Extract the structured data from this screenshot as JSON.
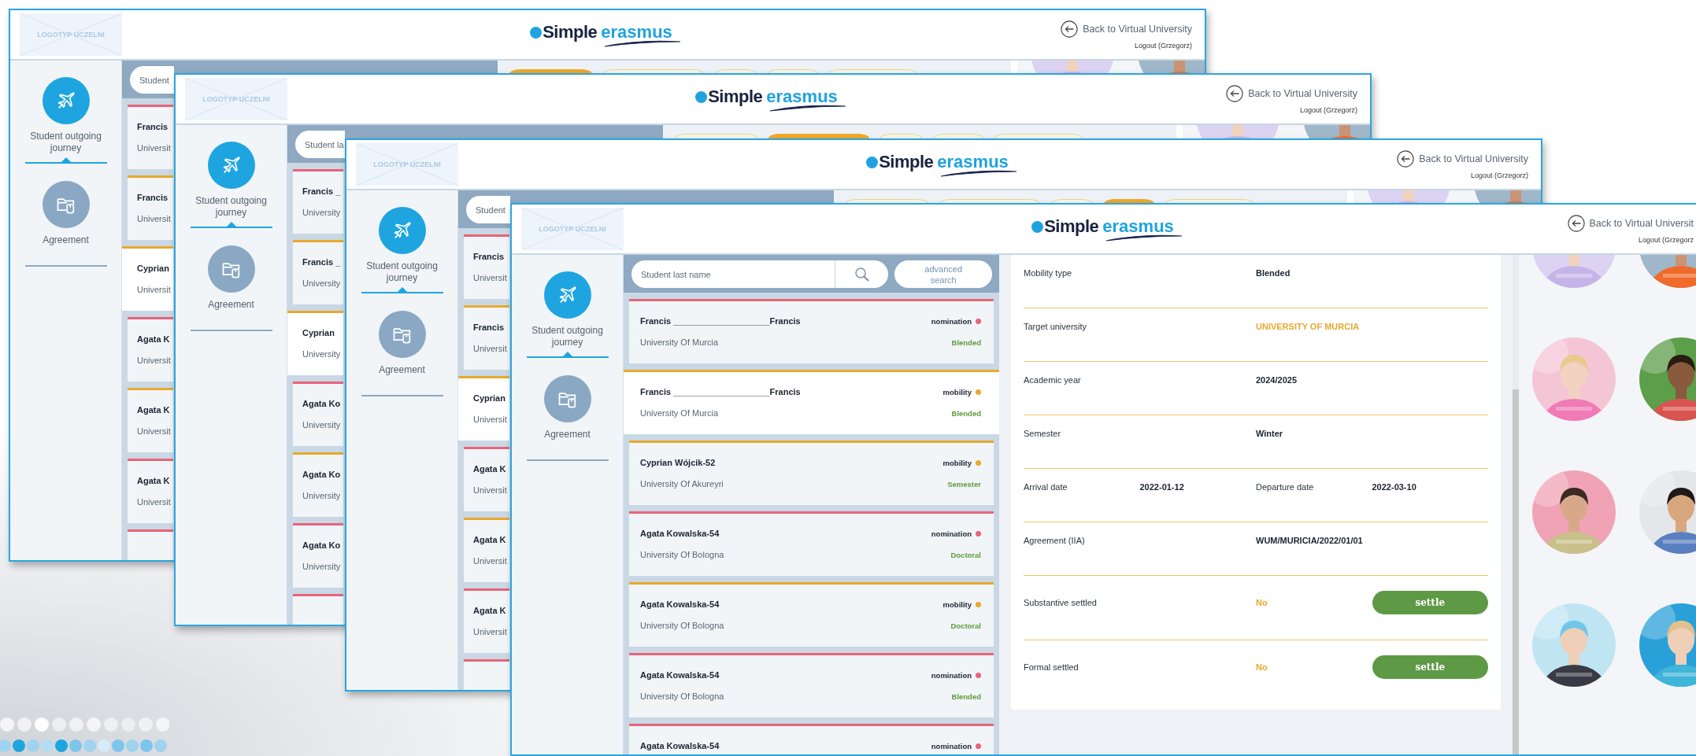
{
  "windows": [
    {
      "header": {
        "logo_placeholder": "LOGOTYP UCZELNI",
        "brand_first": "Simple",
        "brand_second": "erasmus",
        "back_link": "Back to Virtual University",
        "logout": "Logout (Grzegorz)"
      },
      "sidebar": {
        "items": [
          {
            "label": "Student outgoing journey",
            "selected": true
          },
          {
            "label": "Agreement",
            "selected": false
          }
        ]
      },
      "search": {
        "placeholder": "Student"
      },
      "list": [
        {
          "name": "Francis",
          "university": "Universit",
          "color": "#e8647a",
          "selected": false
        },
        {
          "name": "Francis",
          "university": "Universit",
          "color": "#e8a92e",
          "selected": false
        },
        {
          "name": "Cyprian",
          "university": "Universit",
          "color": "#e8a92e",
          "selected": true
        },
        {
          "name": "Agata K",
          "university": "Universit",
          "color": "#e8647a",
          "selected": false
        },
        {
          "name": "Agata K",
          "university": "Universit",
          "color": "#e8a92e",
          "selected": false
        },
        {
          "name": "Agata K",
          "university": "Universit",
          "color": "#e8647a",
          "selected": false
        },
        {
          "color": "#e8647a",
          "selected": false
        }
      ],
      "tabs": [
        {
          "selected": true
        },
        {
          "selected": false
        },
        {
          "selected": false
        },
        {
          "selected": false
        },
        {
          "selected": false
        }
      ]
    },
    {
      "header": {
        "logo_placeholder": "LOGOTYP UCZELNI",
        "brand_first": "Simple",
        "brand_second": "erasmus",
        "back_link": "Back to Virtual University",
        "logout": "Logout (Grzegorz)"
      },
      "sidebar": {
        "items": [
          {
            "label": "Student outgoing journey",
            "selected": true
          },
          {
            "label": "Agreement",
            "selected": false
          }
        ]
      },
      "search": {
        "placeholder": "Student la"
      },
      "list": [
        {
          "name": "Francis _",
          "university": "University",
          "color": "#e8647a",
          "selected": false
        },
        {
          "name": "Francis _",
          "university": "University",
          "color": "#e8a92e",
          "selected": false
        },
        {
          "name": "Cyprian",
          "university": "University",
          "color": "#e8a92e",
          "selected": true
        },
        {
          "name": "Agata Ko",
          "university": "University",
          "color": "#e8647a",
          "selected": false
        },
        {
          "name": "Agata Ko",
          "university": "University",
          "color": "#e8a92e",
          "selected": false
        },
        {
          "name": "Agata Ko",
          "university": "University",
          "color": "#e8647a",
          "selected": false
        },
        {
          "color": "#e8647a",
          "selected": false
        }
      ],
      "tabs": [
        {
          "selected": false
        },
        {
          "selected": true
        },
        {
          "selected": false
        },
        {
          "selected": false
        },
        {
          "selected": false
        }
      ]
    },
    {
      "header": {
        "logo_placeholder": "LOGOTYP UCZELNI",
        "brand_first": "Simple",
        "brand_second": "erasmus",
        "back_link": "Back to Virtual University",
        "logout": "Logout (Grzegorz)"
      },
      "sidebar": {
        "items": [
          {
            "label": "Student outgoing journey",
            "selected": true
          },
          {
            "label": "Agreement",
            "selected": false
          }
        ]
      },
      "search": {
        "placeholder": "Student"
      },
      "list": [
        {
          "name": "Francis",
          "university": "Universit",
          "color": "#e8647a",
          "selected": false
        },
        {
          "name": "Francis",
          "university": "Universit",
          "color": "#e8a92e",
          "selected": false
        },
        {
          "name": "Cyprian",
          "university": "Universit",
          "color": "#e8a92e",
          "selected": true
        },
        {
          "name": "Agata K",
          "university": "Universit",
          "color": "#e8647a",
          "selected": false
        },
        {
          "name": "Agata K",
          "university": "Universit",
          "color": "#e8a92e",
          "selected": false
        },
        {
          "name": "Agata K",
          "university": "Universit",
          "color": "#e8647a",
          "selected": false
        },
        {
          "color": "#e8647a",
          "selected": false
        }
      ],
      "tabs": [
        {
          "selected": false
        },
        {
          "selected": false
        },
        {
          "selected": false
        },
        {
          "selected": true
        },
        {
          "selected": false
        }
      ]
    },
    {
      "header": {
        "logo_placeholder": "LOGOTYP UCZELNI",
        "brand_first": "Simple",
        "brand_second": "erasmus",
        "back_link": "Back to Virtual Universit",
        "logout": "Logout (Grzegorz"
      },
      "sidebar": {
        "items": [
          {
            "label": "Student outgoing journey",
            "selected": true
          },
          {
            "label": "Agreement",
            "selected": false
          }
        ]
      },
      "search": {
        "placeholder": "Student last name",
        "advanced": "advanced search"
      },
      "list": [
        {
          "name": "Francis ____________________Francis",
          "university": "University Of Murcia",
          "status": "nomination",
          "type": "Blended",
          "color": "#e8647a",
          "selected": false
        },
        {
          "name": "Francis ____________________Francis",
          "university": "University Of Murcia",
          "status": "mobility",
          "type": "Blended",
          "color": "#e8a92e",
          "selected": true
        },
        {
          "name": "Cyprian Wójcik-52",
          "university": "University Of Akureyri",
          "status": "mobility",
          "type": "Semester",
          "color": "#e8a92e",
          "selected": false
        },
        {
          "name": "Agata Kowalska-54",
          "university": "University Of Bologna",
          "status": "nomination",
          "type": "Doctoral",
          "color": "#e8647a",
          "selected": false
        },
        {
          "name": "Agata Kowalska-54",
          "university": "University Of Bologna",
          "status": "mobility",
          "type": "Doctoral",
          "color": "#e8a92e",
          "selected": false
        },
        {
          "name": "Agata Kowalska-54",
          "university": "University Of Bologna",
          "status": "nomination",
          "type": "Blended",
          "color": "#e8647a",
          "selected": false
        },
        {
          "name": "Agata Kowalska-54",
          "status": "nomination",
          "color": "#e8647a",
          "selected": false
        }
      ],
      "details": [
        {
          "kind": "field",
          "label": "Mobility type",
          "value": "Blended",
          "accent": false
        },
        {
          "kind": "field",
          "label": "Target university",
          "value": "UNIVERSITY OF MURCIA",
          "accent": true
        },
        {
          "kind": "field",
          "label": "Academic year",
          "value": "2024/2025",
          "accent": false
        },
        {
          "kind": "field",
          "label": "Semester",
          "value": "Winter",
          "accent": false
        },
        {
          "kind": "dates",
          "label": "Arrival date",
          "value": "2022-01-12",
          "label2": "Departure date",
          "value2": "2022-03-10",
          "accent": false
        },
        {
          "kind": "field",
          "label": "Agreement (IIA)",
          "value": "WUM/MURICIA/2022/01/01",
          "accent": false
        },
        {
          "kind": "settle",
          "label": "Substantive settled",
          "value": "No",
          "accent": true,
          "button": "settle"
        },
        {
          "kind": "settle",
          "label": "Formal settled",
          "value": "No",
          "accent": true,
          "button": "settle"
        }
      ]
    }
  ]
}
